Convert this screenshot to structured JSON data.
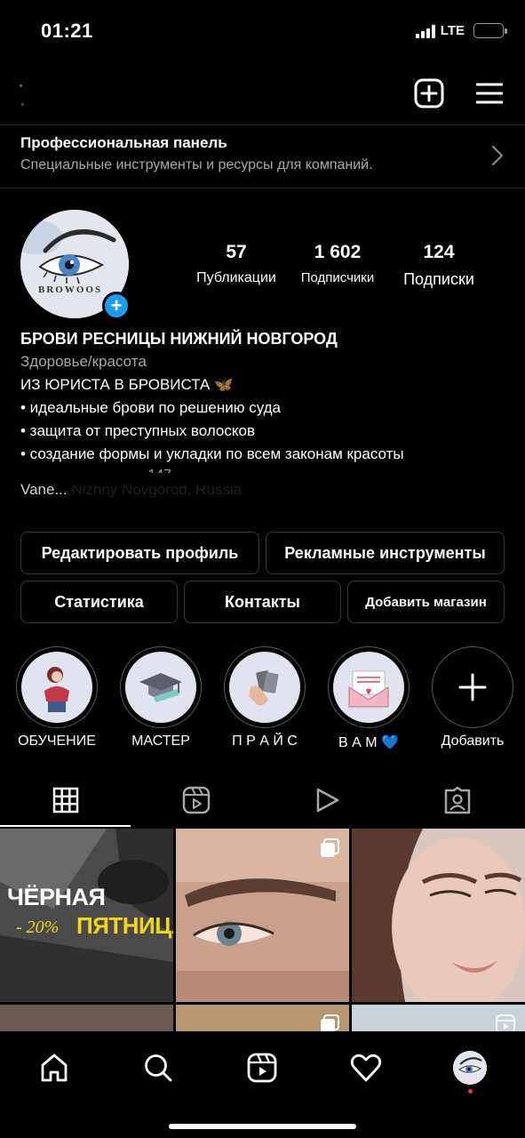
{
  "status_bar": {
    "time": "01:21",
    "network": "LTE"
  },
  "pro_panel": {
    "title": "Профессиональная панель",
    "subtitle": "Специальные инструменты и ресурсы для компаний."
  },
  "profile": {
    "avatar_text": "BROWOOS",
    "stats": [
      {
        "value": "57",
        "label": "Публикации"
      },
      {
        "value": "1 602",
        "label": "Подписчики"
      },
      {
        "value": "124",
        "label": "Подписки"
      }
    ],
    "name": "БРОВИ РЕСНИЦЫ НИЖНИЙ НОВГОРОД",
    "category": "Здоровье/красота",
    "bio": [
      "ИЗ ЮРИСТА В БРОВИСТА 🦋",
      "• идеальные брови по решению суда",
      "• защита от преступных волосков",
      "• создание формы и укладки по всем законам красоты"
    ],
    "bio_partial": "...147",
    "location": "Vane... Nizhny Novgorod, Russia"
  },
  "buttons": {
    "edit_profile": "Редактировать профиль",
    "ad_tools": "Рекламные инструменты",
    "stats": "Статистика",
    "contacts": "Контакты",
    "add_shop": "Добавить магазин"
  },
  "highlights": [
    {
      "label": "ОБУЧЕНИЕ"
    },
    {
      "label": "МАСТЕР"
    },
    {
      "label": "П Р А Й С"
    },
    {
      "label": "В А М 💙"
    },
    {
      "label": "Добавить"
    }
  ],
  "posts": [
    {
      "line1": "ЧЁРНАЯ",
      "line2": "- 20%",
      "line3": "ПЯТНИЦА"
    }
  ],
  "colors": {
    "accent": "#1d9bf0",
    "background": "#000000",
    "border": "#363636",
    "secondary_text": "#a8a8a8",
    "promo_yellow": "#f2d51a"
  },
  "icons": {
    "top_bar": [
      "new-post-icon",
      "menu-icon"
    ],
    "tabs": [
      "grid-icon",
      "reels-icon",
      "video-icon",
      "tagged-icon"
    ],
    "nav": [
      "home-icon",
      "search-icon",
      "reels-icon",
      "heart-icon",
      "profile-avatar"
    ]
  }
}
